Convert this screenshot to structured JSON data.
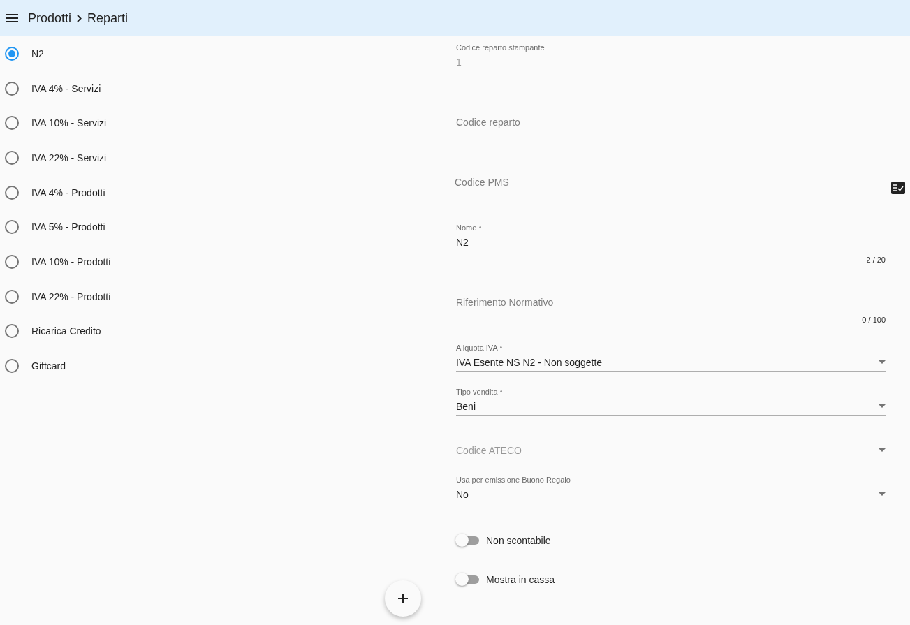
{
  "header": {
    "breadcrumb": [
      "Prodotti",
      "Reparti"
    ]
  },
  "departments": [
    {
      "label": "N2",
      "selected": true
    },
    {
      "label": "IVA 4% - Servizi",
      "selected": false
    },
    {
      "label": "IVA 10% - Servizi",
      "selected": false
    },
    {
      "label": "IVA 22% - Servizi",
      "selected": false
    },
    {
      "label": "IVA 4% - Prodotti",
      "selected": false
    },
    {
      "label": "IVA 5% - Prodotti",
      "selected": false
    },
    {
      "label": "IVA 10% - Prodotti",
      "selected": false
    },
    {
      "label": "IVA 22% - Prodotti",
      "selected": false
    },
    {
      "label": "Ricarica Credito",
      "selected": false
    },
    {
      "label": "Giftcard",
      "selected": false
    }
  ],
  "form": {
    "fields": [
      {
        "kind": "text",
        "label": "Codice reparto stampante",
        "value": "1",
        "disabled": true
      },
      {
        "kind": "text",
        "placeholder": "Codice reparto",
        "disabled": false
      },
      {
        "kind": "text",
        "placeholder": "Codice PMS",
        "disabled": false,
        "action": true
      },
      {
        "kind": "text",
        "label": "Nome *",
        "value": "N2",
        "counter": "2 / 20",
        "disabled": false
      },
      {
        "kind": "text",
        "placeholder": "Riferimento Normativo",
        "counter": "0 / 100",
        "disabled": false
      },
      {
        "kind": "select",
        "label": "Aliquota IVA *",
        "value": "IVA Esente NS N2 - Non soggette"
      },
      {
        "kind": "select",
        "label": "Tipo vendita *",
        "value": "Beni"
      },
      {
        "kind": "select",
        "placeholder": "Codice ATECO"
      },
      {
        "kind": "select",
        "label": "Usa per emissione Buono Regalo",
        "value": "No"
      },
      {
        "kind": "switch",
        "label": "Non scontabile",
        "on": false
      },
      {
        "kind": "switch",
        "label": "Mostra in cassa",
        "on": false
      }
    ]
  }
}
